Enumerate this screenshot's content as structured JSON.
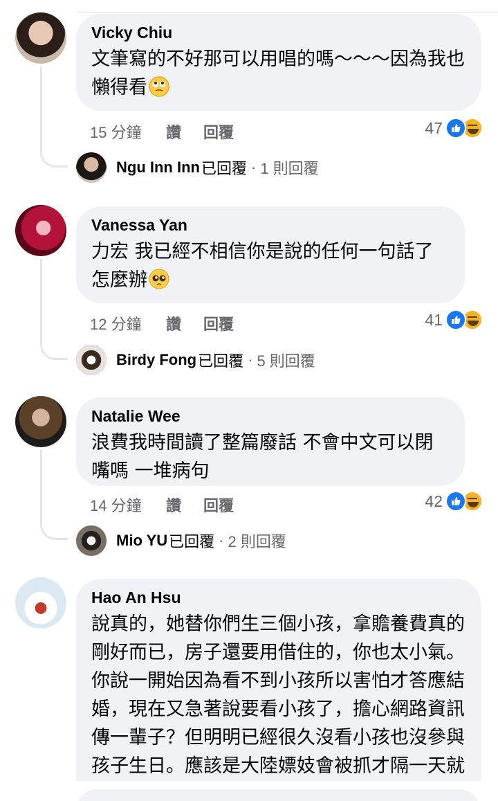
{
  "comments": [
    {
      "author": "Vicky Chiu",
      "text": "文筆寫的不好那可以用唱的嗎～～～因為我也懶得看",
      "emoji": "rolling-eyes-emoji",
      "time": "15 分鐘",
      "like": "讚",
      "reply": "回覆",
      "reaction_count": "47",
      "replies": {
        "name": "Ngu Inn Inn",
        "label": "已回覆",
        "count": "1 則回覆"
      }
    },
    {
      "author": "Vanessa Yan",
      "text": "力宏 我已經不相信你是說的任何一句話了怎麼辦",
      "emoji": "pleading-face-emoji",
      "time": "12 分鐘",
      "like": "讚",
      "reply": "回覆",
      "reaction_count": "41",
      "replies": {
        "name": "Birdy Fong",
        "label": "已回覆",
        "count": "5 則回覆"
      }
    },
    {
      "author": "Natalie Wee",
      "text": "浪費我時間讀了整篇廢話 不會中文可以閉嘴嗎 一堆病句",
      "time": "14 分鐘",
      "like": "讚",
      "reply": "回覆",
      "reaction_count": "42",
      "replies": {
        "name": "Mio YU",
        "label": "已回覆",
        "count": "2 則回覆"
      }
    },
    {
      "author": "Hao An Hsu",
      "text": "說真的，她替你們生三個小孩，拿贍養費真的剛好而已，房子還要用借住的，你也太小氣。你說一開始因為看不到小孩所以害怕才答應結婚，現在又急著說要看小孩了，擔心網路資訊傳一輩子？但明明已經很久沒看小孩也沒參與孩子生日。應該是大陸嫖妓會被抓才隔一天就捍回台灣吧，"
    }
  ],
  "reaction_icons": [
    "like-icon",
    "haha-icon"
  ],
  "colors": {
    "bubble": "#f0f2f5",
    "meta": "#65676b",
    "like_blue": "#1877f2",
    "haha_yellow": "#f7b125"
  }
}
